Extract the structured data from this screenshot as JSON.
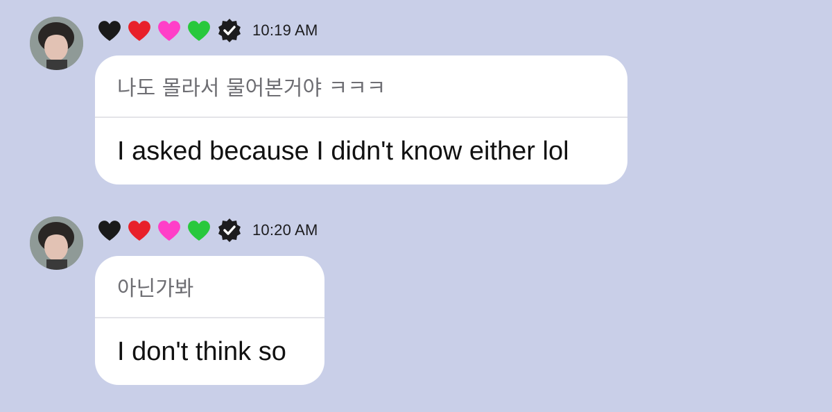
{
  "chat": {
    "messages": [
      {
        "sender_hearts": [
          "black-heart",
          "red-heart",
          "pink-heart",
          "green-heart"
        ],
        "verified": true,
        "time": "10:19 AM",
        "original_text": "나도 몰라서 물어본거야 ㅋㅋㅋ",
        "translated_text": "I asked because I didn't know either lol"
      },
      {
        "sender_hearts": [
          "black-heart",
          "red-heart",
          "pink-heart",
          "green-heart"
        ],
        "verified": true,
        "time": "10:20 AM",
        "original_text": "아닌가봐",
        "translated_text": "I don't think so"
      }
    ]
  },
  "colors": {
    "background": "#c9cfe8",
    "bubble": "#ffffff",
    "black_heart": "#1a1a1a",
    "red_heart": "#e8202a",
    "pink_heart": "#ff3fc8",
    "green_heart": "#28c83c",
    "verified_badge": "#1c1c1e"
  }
}
